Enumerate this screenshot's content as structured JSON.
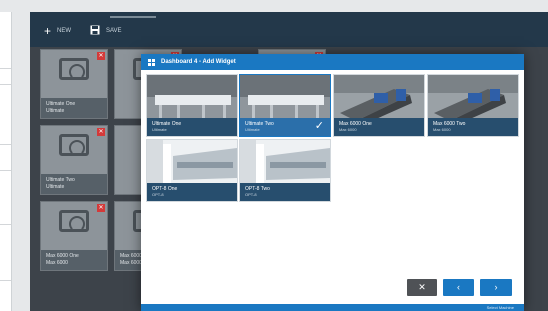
{
  "toolbar": {
    "new_label": "NEW",
    "save_label": "SAVE",
    "new_icon": "plus-icon",
    "save_icon": "floppy-disk-icon"
  },
  "background_widgets": [
    {
      "name": "Ultimate One",
      "sub": "Ultimate"
    },
    {
      "name": "Ultimate Two",
      "sub": "Ultimate"
    },
    {
      "name": "Max 6000 One",
      "sub": "Max 6000"
    },
    {
      "name": "Max 6000 Two",
      "sub": "Max 6000"
    }
  ],
  "modal": {
    "title": "Dashboard 4 - Add Widget",
    "machines": [
      {
        "name": "Ultimate One",
        "sub": "Ultimate",
        "selected": false
      },
      {
        "name": "Ultimate Two",
        "sub": "Ultimate",
        "selected": true
      },
      {
        "name": "Max 6000 One",
        "sub": "Max 6000",
        "selected": false
      },
      {
        "name": "Max 6000 Two",
        "sub": "Max 6000",
        "selected": false
      },
      {
        "name": "OPT-8 One",
        "sub": "OPT-8",
        "selected": false
      },
      {
        "name": "OPT-8 Two",
        "sub": "OPT-8",
        "selected": false
      }
    ],
    "buttons": {
      "close": "✕",
      "prev": "‹",
      "next": "›"
    },
    "footer_label": "Select Machine"
  },
  "colors": {
    "accent": "#1a78c2",
    "topbar": "#23384a",
    "delete": "#d43a3a",
    "caption": "#274e6e"
  }
}
